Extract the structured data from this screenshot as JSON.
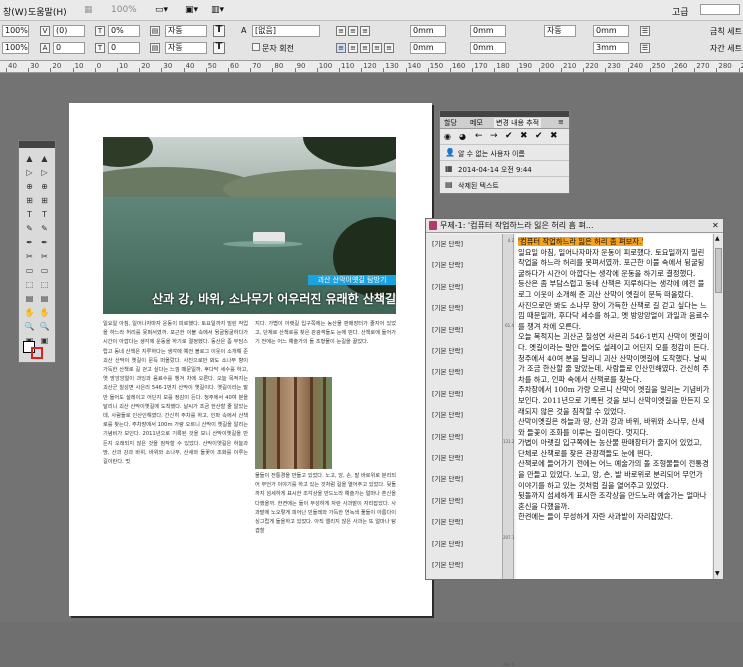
{
  "menu": {
    "window": "창(W)",
    "help": "도움말(H)",
    "zoom": "100%",
    "workspace": "고급"
  },
  "control": {
    "scale_x": "100%",
    "scale_y": "100%",
    "skew": "(0)",
    "rotate": "0%",
    "tracking": "0",
    "font_style": "자동",
    "font_style2": "자동",
    "lang": "[없음]",
    "char_rotate": "문자 회전",
    "indent_left": "0mm",
    "indent_right": "0mm",
    "space_before": "0mm",
    "space_after": "0mm",
    "drop_cap": "자동",
    "spacing": "0mm",
    "spacing2": "3mm",
    "kinsoku": "금칙 세트",
    "mojikumi": "자간 세트",
    "t_label": "T",
    "a_label": "A",
    "zero": "0"
  },
  "ruler": {
    "ticks": [
      "40",
      "30",
      "20",
      "10",
      "0",
      "10",
      "20",
      "30",
      "40",
      "50",
      "60",
      "70",
      "80",
      "90",
      "100",
      "110",
      "120",
      "130",
      "140",
      "150",
      "160",
      "170",
      "180",
      "190",
      "200",
      "210",
      "220",
      "230",
      "240",
      "250",
      "260",
      "270",
      "280",
      "290"
    ]
  },
  "document": {
    "tag": "괴산 산막이옛길 탐방기",
    "headline": "산과 강, 바위, 소나무가 어우러진 유래한 산책길",
    "col1": "일요일 아침, 일어나자마자 운동이 피로했다. 토요일까지 밀린 작업을 하느라 허리를 못펴서였까. 포근한 이불 속에서 뒹굴뒹굴하다가 시간이 아깝다는 생각에 운동을 하기로 결정했다. 동산은 좀 부담스럽고 동네 산책은 지루하다는 생각에 예전 블로그 이웃이 소개해 준 괴산 산막이 옛길이 문득 떠올랐다. 사진으로만 봐도 소나무 향이 가득한 산책로 길 걷고 싶다는 느낌 때문일까, 후다닥 세수를 하고, 옛 방앙앙얼이 과잉과 음료수를 챙겨 차에 오른다. 오늘 목적지는 괴산군 칠성면 사은리 546-1번지 산막이 옛길이다. 옛길이라는 말만 들어도 설레이고 어딘지 모를 정감이 든다. 청주에서 40여 분을 달리니 괴산 산막이옛길에 도착했다. 날씨가 조금 한산할 줄 알았는데, 사람들로 인산인해였다. 간신히 주차를 하고, 인파 속에서 산책로를 찾는다. 주차장에서 100m 가량 오르니 산막이 옛길을 알리는 기념비가 보인다. 2011년으로 기록된 것을 보니 산막이옛길을 만든지 오래되지 않은 것을 짐작할 수 있었다. 산막이옛길은 하늘과 땅, 산과 강과 바위, 바위와 소나무, 산새와 들꽃이 조화를 이루는 길이란다. 멋",
    "col2a": "지다. 가볍이 아랫길 입구쪽에는 농산물 판매장터가 줄지어 있었고, 단체로 산책로를 찾은 관광객들도 눈에 띈다. 산책로에 들어가기 전에는 어느 예술가의 돌 조형물이 눈길을 끌었다.",
    "col2b": "물들이 전통경을 만들고 있었다. 노고, 앙, 손, 발 바로위로 분리되어 무언가 이야기를 하고 있는 것처럼 길을 열어주고 있었다. 뒷돌까지 섬세하게 표시한 조각상을 만드노라 예술가는 얼마나 혼신을 다했을까. 한켠에는 들이 무성하게 자란 사과밭이 자리잡았다. 사과밭에 노오랗게 피어난 민들레와 가득한 연녹색 풀들이 아름다이 싱그럽게 들을하고 있었다. 아직 앨리지 않은 사과는 또 얼마나 탐겹할"
  },
  "tools": {
    "labels": [
      "▲",
      "▷",
      "⊕",
      "⊞",
      "T",
      "✎",
      "✒",
      "✂",
      "▭",
      "⬚",
      "▤",
      "✋",
      "🔍",
      "▣"
    ]
  },
  "track_panel": {
    "tabs": [
      "할당",
      "메모",
      "변경 내용 추적"
    ],
    "user": "알 수 없는 사용자 이름",
    "datetime": "2014-04-14 오전 9:44",
    "change_type": "삭제된 텍스트"
  },
  "story_editor": {
    "title": "무제-1: '컴퓨터 작업하느라 잃은 허리 흠 펴...",
    "styles": [
      "[기본 단락]",
      "[기본 단락]",
      "[기본 단락]",
      "[기본 단락]",
      "[기본 단락]",
      "[기본 단락]",
      "[기본 단락]",
      "[기본 단락]",
      "[기본 단락]",
      "[기본 단락]",
      "[기본 단락]",
      "[기본 단락]",
      "[기본 단락]",
      "[기본 단락]",
      "[기본 단락]",
      "[기본 단락]"
    ],
    "line_numbers": [
      "4.2",
      "",
      "",
      "",
      "",
      "",
      "",
      "",
      "61.4",
      "",
      "",
      "",
      "",
      "",
      "",
      "",
      "",
      "",
      "",
      "131.2",
      "",
      "",
      "",
      "",
      "",
      "",
      "",
      "",
      "207.1",
      "",
      "",
      "",
      "",
      "",
      "",
      "",
      "",
      "",
      "",
      "",
      "262.5"
    ],
    "highlight": "'컴퓨터 작업하느라 잃은 허리 좀 펴보자.'",
    "lines": [
      "일요일 아침, 일어나자마자 운동이 피로했다. 토요일까지 밀린 작업을 하느라 허리를 못펴서였까. 포근한 이불 속에서 뒹굴뒹굴하다가 시간이 아깝다는 생각에 운동을 하기로 결정했다.",
      "등산은 좀 부담스럽고 동네 산책은 지루하다는 생각에 예전 블로그 이웃이 소개해 준 괴산 산막이 옛길이 문득 떠올랐다.",
      "사진으로만 봐도 소나무 향이 가득한 산책로 길 걷고 싶다는 느낌 때문일까, 후다닥 세수를 하고, 옛 방앙앙얼이 과일과 음료수를 챙겨 차에 오른다.",
      "오늘 목적지는 괴산군 칠성면 사은리 546-1번지 산막이 옛길이다. 옛길이라는 말만 들어도 설레이고 어딘지 모를 정감이 든다.",
      "청주에서 40여 분을 달리니 괴산 산막이옛길에 도착했다. 날씨가 조금 한산할 줄 알았는데, 사람들로 인산인해였다. 간신히 주차를 하고, 인파 속에서 산책로를 찾는다.",
      "주차장에서 100m 가량 오르니 산막이 옛길을 알리는 기념비가 보인다. 2011년으로 기록된 것을 보니 산막이옛길을 만든지 오래되지 않은 것을 짐작할 수 있었다.",
      "산막이옛길은 하늘과 땅, 산과 강과 바위, 바위와 소나무, 산새와 들꽃이 조화를 이루는 길이란다. 멋지다.",
      "가볍이 아랫길 입구쪽에는 농산물 판매장터가 줄지어 있었고, 단체로 산책로를 찾은 관광객들도 눈에 띈다.",
      "산책로에 들어가기 전에는 어느 예술가의 돌 조형물들이 전통경을 만들고 있었다. 노고, 앙, 손, 발 바로위로 분리되어 무언가 이야기를 하고 있는 것처럼 길을 열어주고 있었다.",
      "뒷돌까지 섬세하게 표시한 조각상을 만드노라 예술가는 얼마나 혼신을 다했을까.",
      "한켠에는 들이 무성하게 자란 사과밭이 자리잡았다."
    ]
  }
}
